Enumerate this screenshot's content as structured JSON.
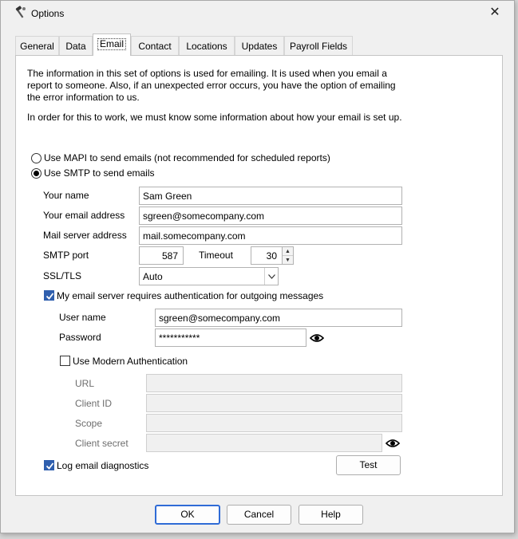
{
  "window": {
    "title": "Options"
  },
  "tabs": [
    "General",
    "Data",
    "Email",
    "Contact",
    "Locations",
    "Updates",
    "Payroll Fields"
  ],
  "intro": {
    "para1": "The information in this set of options is used for emailing. It is used when you email a report to someone. Also, if an unexpected error occurs, you have the option of emailing the error information to us.",
    "para2": "In order for this to work, we must know some information about how your email is set up."
  },
  "send_method": {
    "mapi_label": "Use MAPI to send emails (not recommended for scheduled reports)",
    "smtp_label": "Use SMTP to send emails",
    "selected": "smtp"
  },
  "smtp": {
    "name_label": "Your name",
    "name_value": "Sam Green",
    "email_label": "Your email address",
    "email_value": "sgreen@somecompany.com",
    "server_label": "Mail server address",
    "server_value": "mail.somecompany.com",
    "port_label": "SMTP port",
    "port_value": "587",
    "timeout_label": "Timeout",
    "timeout_value": "30",
    "ssl_label": "SSL/TLS",
    "ssl_value": "Auto"
  },
  "auth": {
    "requires_label": "My email server requires authentication for outgoing messages",
    "requires_checked": true,
    "user_label": "User name",
    "user_value": "sgreen@somecompany.com",
    "password_label": "Password",
    "password_value": "***********",
    "modern_label": "Use Modern Authentication",
    "modern_checked": false,
    "url_label": "URL",
    "client_id_label": "Client ID",
    "scope_label": "Scope",
    "client_secret_label": "Client secret"
  },
  "diagnostics": {
    "label": "Log email diagnostics",
    "checked": true,
    "test_button": "Test"
  },
  "footer": {
    "ok": "OK",
    "cancel": "Cancel",
    "help": "Help"
  }
}
